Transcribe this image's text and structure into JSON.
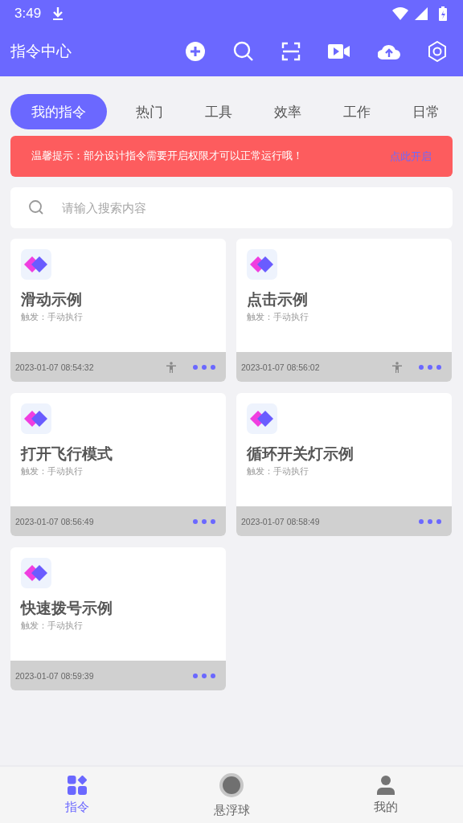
{
  "status_bar": {
    "time": "3:49"
  },
  "app_bar": {
    "title": "指令中心"
  },
  "tabs": [
    {
      "label": "我的指令",
      "selected": true
    },
    {
      "label": "热门",
      "selected": false
    },
    {
      "label": "工具",
      "selected": false
    },
    {
      "label": "效率",
      "selected": false
    },
    {
      "label": "工作",
      "selected": false
    },
    {
      "label": "日常",
      "selected": false
    }
  ],
  "notice": {
    "text": "温馨提示：部分设计指令需要开启权限才可以正常运行哦！",
    "link": "点此开启"
  },
  "search": {
    "placeholder": "请输入搜索内容"
  },
  "cards": [
    {
      "title": "滑动示例",
      "trigger": "触发：手动执行",
      "time": "2023-01-07 08:54:32",
      "accessibility": true
    },
    {
      "title": "点击示例",
      "trigger": "触发：手动执行",
      "time": "2023-01-07 08:56:02",
      "accessibility": true
    },
    {
      "title": "打开飞行模式",
      "trigger": "触发：手动执行",
      "time": "2023-01-07 08:56:49",
      "accessibility": false
    },
    {
      "title": "循环开关灯示例",
      "trigger": "触发：手动执行",
      "time": "2023-01-07 08:58:49",
      "accessibility": false
    },
    {
      "title": "快速拨号示例",
      "trigger": "触发：手动执行",
      "time": "2023-01-07 08:59:39",
      "accessibility": false
    }
  ],
  "bottom_nav": [
    {
      "label": "指令",
      "kind": "grid",
      "selected": true
    },
    {
      "label": "悬浮球",
      "kind": "ball",
      "selected": false
    },
    {
      "label": "我的",
      "kind": "person",
      "selected": false
    }
  ]
}
